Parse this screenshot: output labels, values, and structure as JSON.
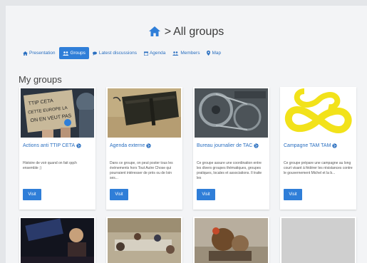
{
  "header": {
    "title": "All groups",
    "separator": ">",
    "home_icon": "home-icon"
  },
  "tabs": [
    {
      "label": "Presentation",
      "icon": "home-icon",
      "active": false
    },
    {
      "label": "Groups",
      "icon": "users-icon",
      "active": true
    },
    {
      "label": "Latest discussions",
      "icon": "comments-icon",
      "active": false
    },
    {
      "label": "Agenda",
      "icon": "calendar-icon",
      "active": false
    },
    {
      "label": "Members",
      "icon": "members-icon",
      "active": false
    },
    {
      "label": "Map",
      "icon": "map-marker-icon",
      "active": false
    }
  ],
  "section_title": "My groups",
  "cards": [
    {
      "name": "Actions anti TTIP CETA",
      "description": "Histoire de voir quand on fait qqch ensemble ;)",
      "visit_label": "Visit"
    },
    {
      "name": "Agenda externe",
      "description": "Dans ce groupe, on peut poster tous les événements hors Tout Autre Chose qui pourraient intéresser de près ou de loin ses...",
      "visit_label": "Visit"
    },
    {
      "name": "Bureau journalier de TAC",
      "description": "Ce groupe assure une coordination entre les divers groupes thématiques, groupes pratiques, locales et associations. Il traite les",
      "visit_label": "Visit"
    },
    {
      "name": "Campagne TAM TAM",
      "description": "Ce groupe prépare une campagne au long court visant à fédérer les résistances contre le gouvernement Michel et la b...",
      "visit_label": "Visit"
    }
  ],
  "sign_text": "TTIP CETA\nCETTE EUROPE LA\nON EN VEUT PAS",
  "theme": {
    "accent": "#2f7ed8",
    "link": "#2a6fc0",
    "yellow": "#f2e21a"
  }
}
